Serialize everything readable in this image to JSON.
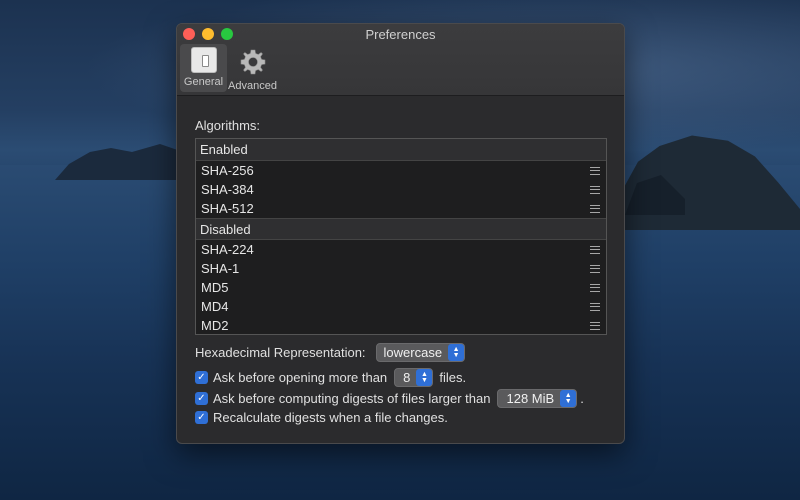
{
  "window": {
    "title": "Preferences"
  },
  "toolbar": {
    "tabs": [
      {
        "label": "General",
        "icon": "general-switch-icon",
        "selected": true
      },
      {
        "label": "Advanced",
        "icon": "gear-icon",
        "selected": false
      }
    ]
  },
  "algorithms": {
    "label": "Algorithms:",
    "enabled": {
      "header": "Enabled",
      "items": [
        "SHA-256",
        "SHA-384",
        "SHA-512"
      ]
    },
    "disabled": {
      "header": "Disabled",
      "items": [
        "SHA-224",
        "SHA-1",
        "MD5",
        "MD4",
        "MD2"
      ]
    }
  },
  "hex": {
    "label": "Hexadecimal Representation:",
    "value": "lowercase"
  },
  "options": {
    "ask_open": {
      "prefix": "Ask before opening more than",
      "value": "8",
      "suffix": "files.",
      "checked": true
    },
    "ask_compute": {
      "prefix": "Ask before computing digests of files larger than",
      "value": "128 MiB",
      "suffix": ".",
      "checked": true
    },
    "recalculate": {
      "label": "Recalculate digests when a file changes.",
      "checked": true
    }
  },
  "colors": {
    "accent": "#2f6fd6",
    "close": "#fe5f57",
    "minimize": "#febc2e",
    "maximize": "#28c840"
  }
}
